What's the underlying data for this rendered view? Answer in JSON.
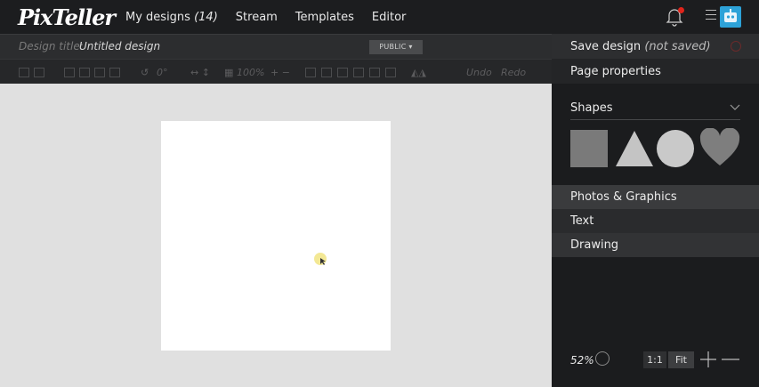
{
  "app": {
    "logo": "PixTeller"
  },
  "nav": {
    "items": [
      {
        "label": "My designs",
        "count": "(14)"
      },
      {
        "label": "Stream"
      },
      {
        "label": "Templates"
      },
      {
        "label": "Editor"
      }
    ]
  },
  "design": {
    "title_label": "Design title:",
    "title_value": "Untitled design",
    "visibility": "PUBLIC"
  },
  "toolbar": {
    "rotation": "0°",
    "opacity": "100%",
    "undo": "Undo",
    "redo": "Redo"
  },
  "panel": {
    "save_label": "Save design",
    "save_status": "(not saved)",
    "page_properties": "Page properties",
    "shapes_label": "Shapes",
    "sections": [
      "Photos & Graphics",
      "Text",
      "Drawing"
    ]
  },
  "zoom": {
    "value": "52%",
    "one_to_one": "1:1",
    "fit": "Fit"
  },
  "colors": {
    "topbar_bg": "#1c1d1f",
    "canvas_bg": "#e0e0e0",
    "page_bg": "#ffffff",
    "accent_red": "#e0241b",
    "avatar_blue": "#2da2d8"
  },
  "icons": [
    "bell-icon",
    "menu-icon",
    "user-avatar-icon",
    "chevron-down-icon",
    "zoom-in-icon",
    "zoom-out-icon"
  ]
}
